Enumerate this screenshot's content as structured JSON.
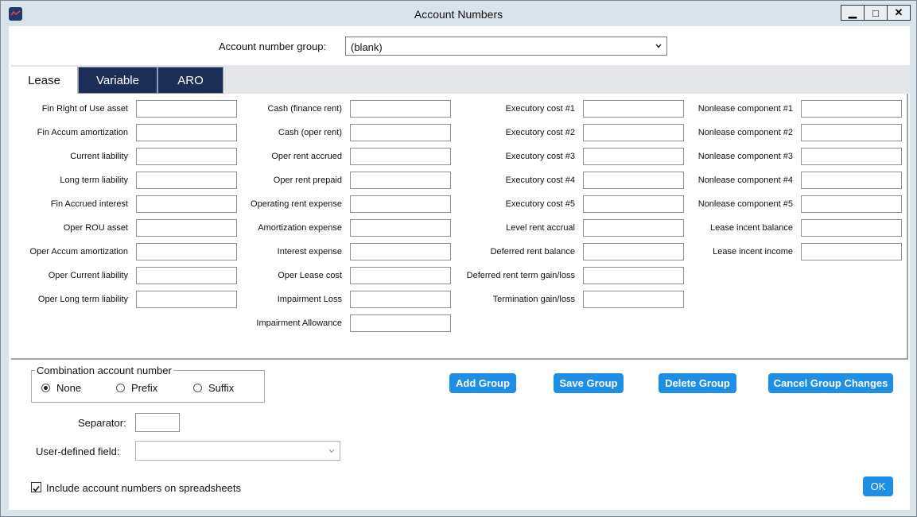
{
  "window": {
    "title": "Account Numbers"
  },
  "controls": {
    "minimize": "▁",
    "maximize": "□",
    "close": "✕"
  },
  "group": {
    "label": "Account number group:",
    "value": "(blank)"
  },
  "tabs": [
    "Lease",
    "Variable",
    "ARO"
  ],
  "fields": {
    "col1": [
      "Fin Right of Use asset",
      "Fin Accum amortization",
      "Current liability",
      "Long term liability",
      "Fin Accrued interest",
      "Oper ROU asset",
      "Oper Accum amortization",
      "Oper Current liability",
      "Oper Long term liability"
    ],
    "col2": [
      "Cash (finance rent)",
      "Cash (oper rent)",
      "Oper rent accrued",
      "Oper rent prepaid",
      "Operating rent expense",
      "Amortization expense",
      "Interest expense",
      "Oper Lease cost",
      "Impairment Loss",
      "Impairment Allowance"
    ],
    "col3": [
      "Executory cost #1",
      "Executory cost #2",
      "Executory cost #3",
      "Executory cost #4",
      "Executory cost #5",
      "Level rent accrual",
      "Deferred rent balance",
      "Deferred rent term gain/loss",
      "Termination gain/loss"
    ],
    "col4": [
      "Nonlease component #1",
      "Nonlease component #2",
      "Nonlease component #3",
      "Nonlease component #4",
      "Nonlease component #5",
      "Lease incent balance",
      "Lease incent income"
    ]
  },
  "combination": {
    "legend": "Combination account number",
    "options": [
      "None",
      "Prefix",
      "Suffix"
    ],
    "selected": "None"
  },
  "buttons": {
    "add": "Add Group",
    "save": "Save Group",
    "delete": "Delete Group",
    "cancel": "Cancel Group Changes",
    "ok": "OK"
  },
  "separator": {
    "label": "Separator:",
    "value": ""
  },
  "udf": {
    "label": "User-defined field:",
    "value": ""
  },
  "include": {
    "label": "Include account numbers on spreadsheets",
    "checked": true
  },
  "colors": {
    "accent": "#1e8fe6",
    "tab_dark": "#1a2e57"
  }
}
